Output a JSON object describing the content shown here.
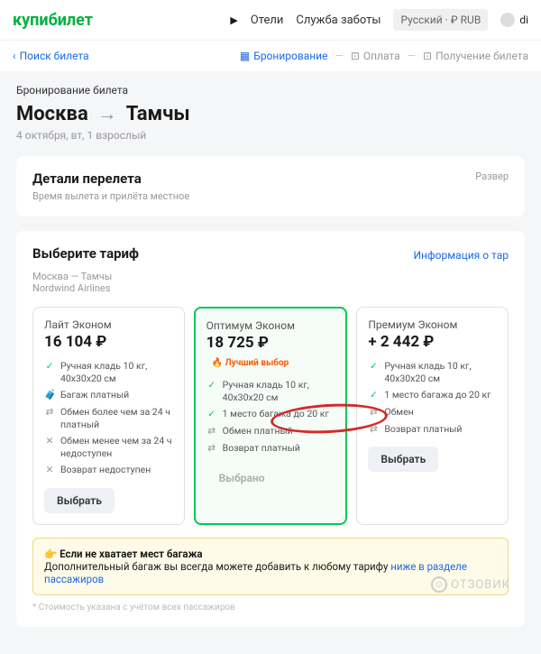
{
  "header": {
    "logo": "купибилет",
    "nav": {
      "hotels": "Отели",
      "support": "Служба заботы"
    },
    "lang": "Русский · ₽ RUB",
    "user": "di"
  },
  "subnav": {
    "back": "Поиск билета",
    "steps": {
      "booking": "Бронирование",
      "payment": "Оплата",
      "receive": "Получение билета"
    }
  },
  "page": {
    "crumb": "Бронирование билета",
    "from": "Москва",
    "to": "Тамчы",
    "details": "4 октября, вт, 1 взрослый"
  },
  "details": {
    "title": "Детали перелета",
    "subtitle": "Время вылета и прилёта местное",
    "expand": "Развер"
  },
  "tarif": {
    "title": "Выберите тариф",
    "info": "Информация о тар",
    "route": "Москва — Тамчы",
    "airline": "Nordwind Airlines",
    "cards": [
      {
        "name": "Лайт Эконом",
        "price": "16 104 ₽",
        "badge": "",
        "features": [
          {
            "icon": "ok",
            "text": "Ручная кладь 10 кг, 40х30х20 см"
          },
          {
            "icon": "bag",
            "text": "Багаж платный"
          },
          {
            "icon": "ex",
            "text": "Обмен более чем за 24 ч платный"
          },
          {
            "icon": "no",
            "text": "Обмен менее чем за 24 ч недоступен"
          },
          {
            "icon": "no",
            "text": "Возврат недоступен"
          }
        ],
        "btn": "Выбрать",
        "selected": false
      },
      {
        "name": "Оптимум Эконом",
        "price": "18 725 ₽",
        "badge": "Лучший выбор",
        "features": [
          {
            "icon": "ok",
            "text": "Ручная кладь 10 кг, 40х30х20 см"
          },
          {
            "icon": "ok",
            "text": "1 место багажа до 20 кг"
          },
          {
            "icon": "ex",
            "text": "Обмен платный"
          },
          {
            "icon": "ex",
            "text": "Возврат платный"
          }
        ],
        "btn": "Выбрано",
        "selected": true
      },
      {
        "name": "Премиум Эконом",
        "price": "+ 2 442 ₽",
        "badge": "",
        "features": [
          {
            "icon": "ok",
            "text": "Ручная кладь 10 кг, 40х30х20 см"
          },
          {
            "icon": "ok",
            "text": "1 место багажа до 20 кг"
          },
          {
            "icon": "ex",
            "text": "Обмен"
          },
          {
            "icon": "ex",
            "text": "Возврат платный"
          }
        ],
        "btn": "Выбрать",
        "selected": false
      }
    ]
  },
  "baggage": {
    "title": "Если не хватает мест багажа",
    "text": "Дополнительный багаж вы всегда можете добавить к любому тарифу ",
    "link": "ниже в разделе пассажиров"
  },
  "footnote": "* Стоимость указана с учётом всех пассажиров",
  "watermark": "ОТЗОВИК"
}
